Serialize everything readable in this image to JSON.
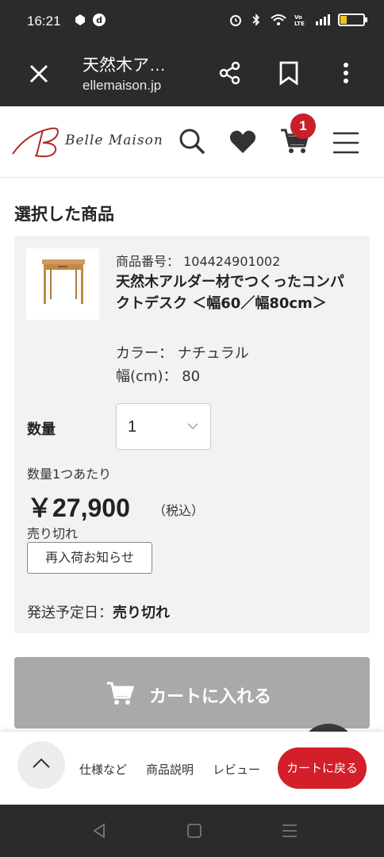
{
  "status_bar": {
    "time": "16:21",
    "battery_level": 0.2,
    "battery_color": "#f3c31a"
  },
  "browser": {
    "title": "天然木ア…",
    "url": "ellemaison.jp",
    "icons": [
      "close-icon",
      "share-icon",
      "bookmark-icon",
      "more-vert-icon"
    ]
  },
  "site_header": {
    "logo_text": "Belle Maison",
    "cart_count": "1",
    "icons": [
      "search-icon",
      "heart-icon",
      "cart-icon",
      "menu-icon"
    ],
    "accent_color": "#c8202a"
  },
  "selected": {
    "section_title": "選択した商品",
    "product_code": "商品番号： 104424901002",
    "product_name": "天然木アルダー材でつくったコンパクトデスク ＜幅60／幅80cm＞",
    "color_attr": "カラー： ナチュラル",
    "width_attr": "幅(cm)： 80",
    "qty_label": "数量",
    "qty_value": "1",
    "per_unit": "数量1つあたり",
    "price": "￥27,900",
    "tax": "（税込）",
    "stock_status": "売り切れ",
    "restock_button": "再入荷お知らせ",
    "ship_label": "発送予定日：",
    "ship_value": "売り切れ"
  },
  "add_to_cart": {
    "label": "カートに入れる",
    "bg_color": "#a9a9a9"
  },
  "bottom_bar": {
    "links": [
      "仕様など",
      "商品説明",
      "レビュー"
    ],
    "back_to_cart": "カートに戻る",
    "back_color": "#d21f2a"
  }
}
